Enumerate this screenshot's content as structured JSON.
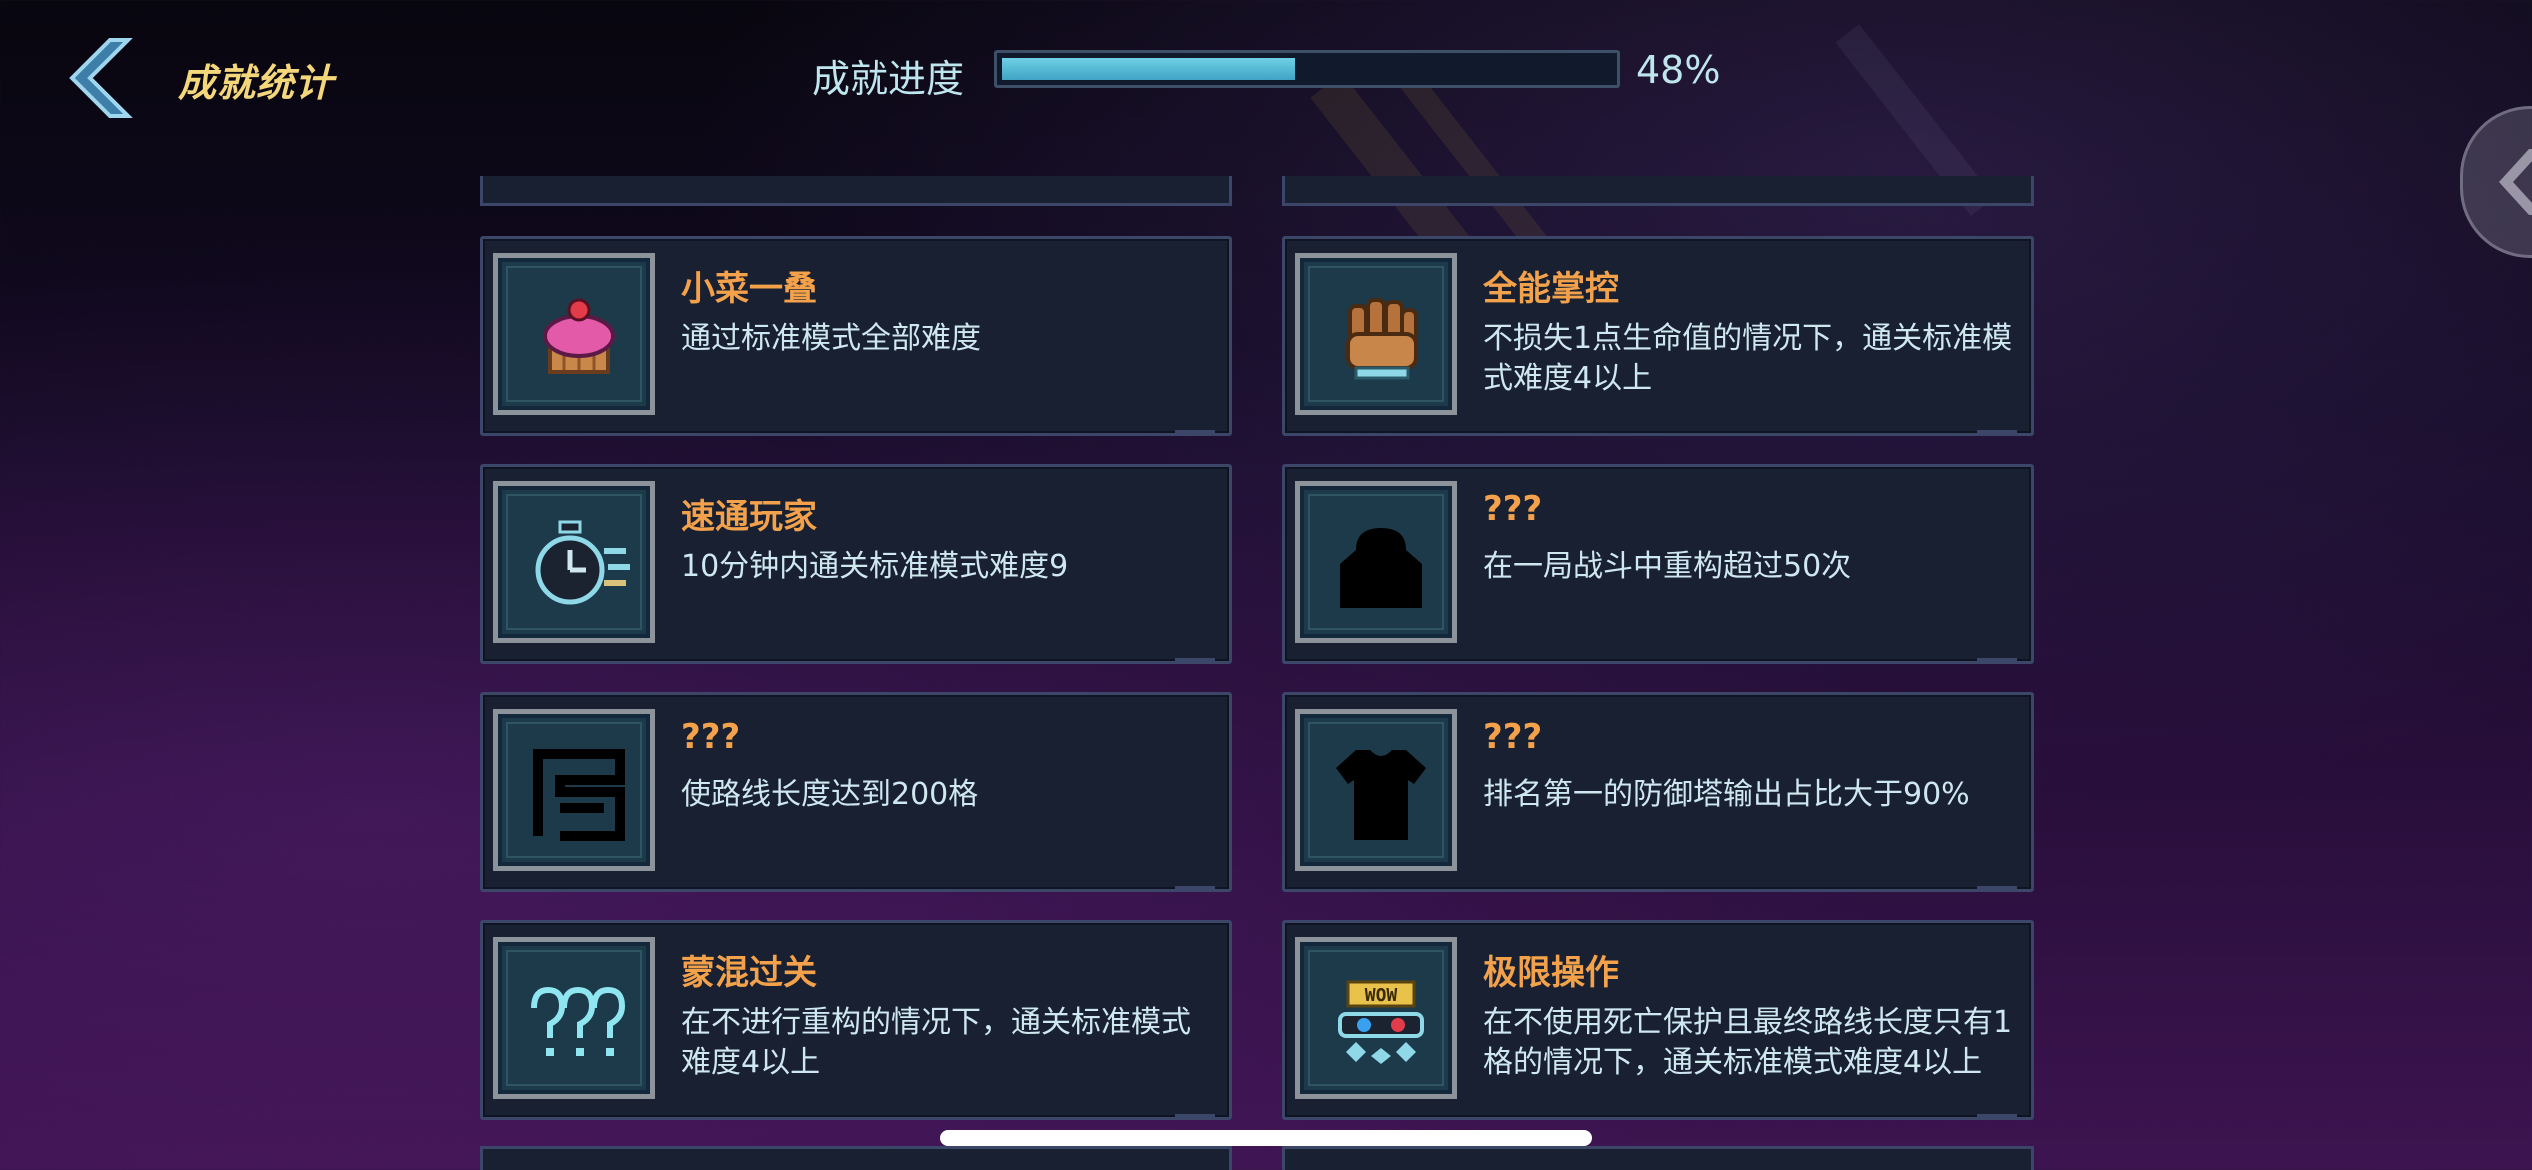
{
  "header": {
    "title": "成就统计",
    "back_icon": "chevron-left-icon",
    "progress_label": "成就进度",
    "progress_fraction": 0.48,
    "progress_value": "48%"
  },
  "side_tab": {
    "icon": "chevron-left-icon"
  },
  "colors": {
    "title": "#f3d77a",
    "card_title": "#f3a24b",
    "card_desc": "#cfe7ef",
    "progress_fill": "#4fb8d4"
  },
  "achievements": [
    {
      "title": "小菜一叠",
      "desc": "通过标准模式全部难度",
      "icon": "cupcake-icon"
    },
    {
      "title": "全能掌控",
      "desc": "不损失1点生命值的情况下，通关标准模式难度4以上",
      "icon": "fist-icon"
    },
    {
      "title": "速通玩家",
      "desc": "10分钟内通关标准模式难度9",
      "icon": "stopwatch-icon"
    },
    {
      "title": "???",
      "desc": "在一局战斗中重构超过50次",
      "icon": "locked-silhouette-icon"
    },
    {
      "title": "???",
      "desc": "使路线长度达到200格",
      "icon": "locked-path-icon"
    },
    {
      "title": "???",
      "desc": "排名第一的防御塔输出占比大于90%",
      "icon": "locked-shirt-icon"
    },
    {
      "title": "蒙混过关",
      "desc": "在不进行重构的情况下，通关标准模式难度4以上",
      "icon": "question-marks-icon"
    },
    {
      "title": "极限操作",
      "desc": "在不使用死亡保护且最终路线长度只有1格的情况下，通关标准模式难度4以上",
      "icon": "wow-icon"
    }
  ]
}
